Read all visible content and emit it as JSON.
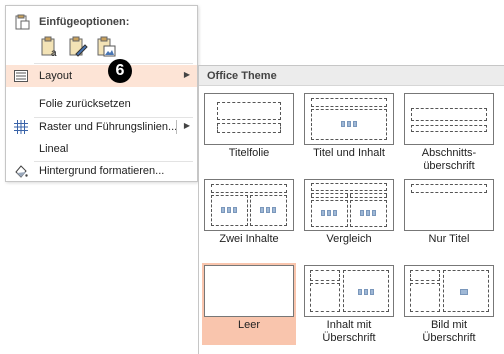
{
  "context_menu": {
    "paste_header": "Einfügeoptionen:",
    "paste_icons": [
      "paste-keep-text-icon",
      "paste-keep-formatting-icon",
      "paste-picture-icon"
    ],
    "items": [
      {
        "label": "Layout",
        "icon": "layout-icon",
        "has_submenu": true,
        "active": true
      },
      {
        "label": "Folie zurücksetzen",
        "icon": "",
        "has_submenu": false
      },
      {
        "label": "Raster und Führungslinien...",
        "icon": "grid-icon",
        "has_submenu": true
      },
      {
        "label": "Lineal",
        "icon": "",
        "has_submenu": false
      },
      {
        "label": "Hintergrund formatieren...",
        "icon": "format-background-icon",
        "has_submenu": false
      }
    ],
    "badge": "6"
  },
  "gallery": {
    "title": "Office Theme",
    "tiles": [
      {
        "label": "Titelfolie",
        "selected": false
      },
      {
        "label": "Titel und Inhalt",
        "selected": false
      },
      {
        "label": "Abschnitts-\nüberschrift",
        "selected": false
      },
      {
        "label": "Zwei Inhalte",
        "selected": false
      },
      {
        "label": "Vergleich",
        "selected": false
      },
      {
        "label": "Nur Titel",
        "selected": false
      },
      {
        "label": "Leer",
        "selected": true
      },
      {
        "label": "Inhalt mit\nÜberschrift",
        "selected": false
      },
      {
        "label": "Bild mit\nÜberschrift",
        "selected": false
      }
    ]
  },
  "colors": {
    "highlight": "#fde4d6",
    "selected_tile": "#f9c5ad"
  }
}
